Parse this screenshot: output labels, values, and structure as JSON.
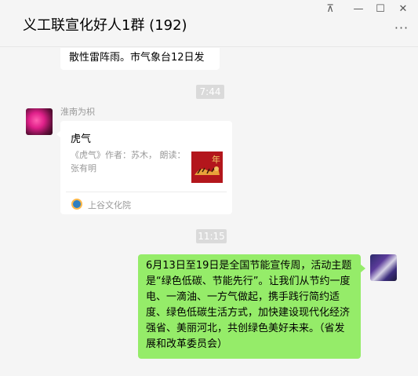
{
  "window": {
    "title": "义工联宣化好人1群 (192)",
    "pin_glyph": "⊼",
    "minimize_glyph": "—",
    "maximize_glyph": "☐",
    "close_glyph": "✕",
    "more_glyph": "···"
  },
  "messages": {
    "top_partial_text": "散性雷阵雨。市气象台12日发",
    "time1": "7:44",
    "link_card": {
      "sender": "淮南为枳",
      "title": "虎气",
      "description": "《虎气》作者：苏木， 朗读：张有明",
      "source": "上谷文化院",
      "thumbnail_char": "年"
    },
    "time2": "11:15",
    "outgoing_text": "6月13日至19日是全国节能宣传周，活动主题是“绿色低碳、节能先行”。让我们从节约一度电、一滴油、一方气做起，携手践行简约适度、绿色低碳生活方式，加快建设现代化经济强省、美丽河北，共创绿色美好未来。（省发展和改革委员会）"
  },
  "colors": {
    "background": "#f5f5f5",
    "own_bubble": "#95ec69",
    "other_bubble": "#ffffff",
    "time_badge": "#dadada"
  }
}
